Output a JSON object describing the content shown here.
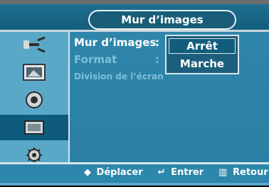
{
  "menu": {
    "title": "Mur d’images",
    "items": [
      {
        "label": "Mur d’images",
        "value_sep": ":"
      },
      {
        "label": "Format",
        "value_sep": ":"
      },
      {
        "label": "Division de l’écran"
      }
    ],
    "dropdown": {
      "options": [
        "Arrêt",
        "Marche"
      ],
      "selected": "Arrêt"
    }
  },
  "sidebar": {
    "items": [
      {
        "icon": "antenna-icon"
      },
      {
        "icon": "picture-icon"
      },
      {
        "icon": "sound-icon"
      },
      {
        "icon": "display-icon"
      },
      {
        "icon": "settings-icon"
      }
    ]
  },
  "help": {
    "move": "Déplacer",
    "enter": "Entrer",
    "back": "Retour"
  },
  "colors": {
    "accent": "#5aa8c8",
    "active": "#0f5b7b",
    "title": "#135d7c"
  }
}
